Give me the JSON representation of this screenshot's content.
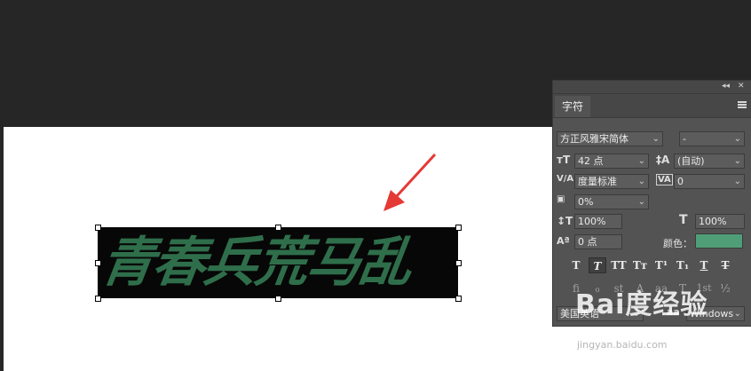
{
  "canvas": {
    "text_layer": "青春兵荒马乱",
    "text_color": "#2f6e4b",
    "bg_color": "#070707"
  },
  "panel": {
    "tab": "字符",
    "collapse_glyph": "◂◂",
    "close_glyph": "✕",
    "font_family": "方正风雅宋简体",
    "font_style": "-",
    "font_size": "42 点",
    "leading": "(自动)",
    "kerning": "度量标准",
    "tracking": "0",
    "tsume": "0%",
    "vertical_scale": "100%",
    "horizontal_scale": "100%",
    "baseline_shift": "0 点",
    "color_label": "颜色：",
    "color_value": "#4f9e78",
    "style_buttons": [
      "T",
      "T",
      "TT",
      "Tт",
      "T¹",
      "T₁",
      "T",
      "T"
    ],
    "opentype_buttons": [
      "fi",
      "ℴ",
      "st",
      "A",
      "aa",
      "T",
      "1st",
      "½"
    ],
    "language": "美国英语",
    "antialias": "Windows"
  },
  "watermark": {
    "logo": "Bai度经验",
    "url": "jingyan.baidu.com"
  }
}
